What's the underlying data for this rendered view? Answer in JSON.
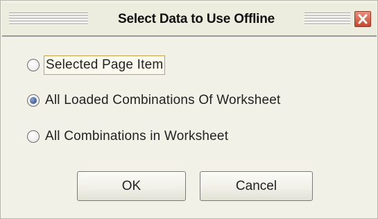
{
  "dialog": {
    "title": "Select Data to Use Offline",
    "close_icon": "close-icon",
    "accent_color": "#3f5f98",
    "close_color": "#c7472c"
  },
  "options": [
    {
      "label": "Selected Page Item",
      "checked": false,
      "focused": true
    },
    {
      "label": "All Loaded Combinations Of Worksheet",
      "checked": true,
      "focused": false
    },
    {
      "label": "All Combinations in Worksheet",
      "checked": false,
      "focused": false
    }
  ],
  "buttons": {
    "ok_label": "OK",
    "cancel_label": "Cancel"
  }
}
